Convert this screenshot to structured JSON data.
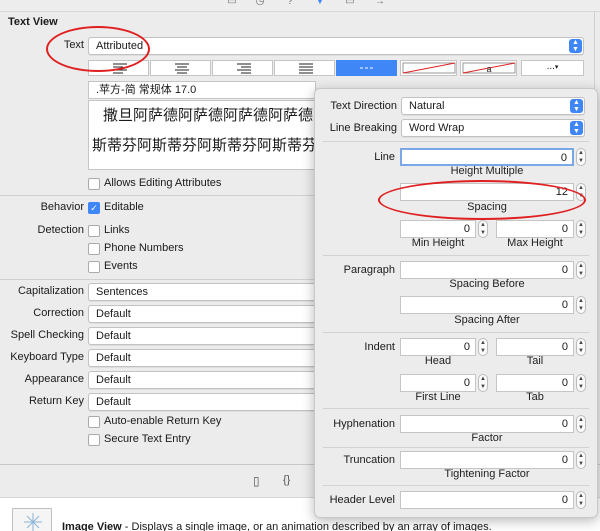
{
  "inspector": {
    "section_title": "Text View",
    "text_label": "Text",
    "text_value": "Attributed",
    "font_value": ".苹方-简 常规体 17.0",
    "preview_line1": "撒旦阿萨德阿萨德阿萨德阿萨德",
    "preview_line2": "斯蒂芬阿斯蒂芬阿斯蒂芬阿斯蒂芬",
    "allows_editing": "Allows Editing Attributes",
    "behavior_label": "Behavior",
    "editable": "Editable",
    "detection_label": "Detection",
    "links": "Links",
    "phone_numbers": "Phone Numbers",
    "events": "Events",
    "capitalization_label": "Capitalization",
    "capitalization_value": "Sentences",
    "correction_label": "Correction",
    "correction_value": "Default",
    "spell_label": "Spell Checking",
    "spell_value": "Default",
    "keyboard_label": "Keyboard Type",
    "keyboard_value": "Default",
    "appearance_label": "Appearance",
    "appearance_value": "Default",
    "return_label": "Return Key",
    "return_value": "Default",
    "auto_enable": "Auto-enable Return Key",
    "secure": "Secure Text Entry",
    "more_label": "...",
    "image_view_bold": "Image View",
    "image_view_desc": " - Displays a single image, or an animation described by an array of images."
  },
  "popover": {
    "text_direction_label": "Text Direction",
    "text_direction_value": "Natural",
    "line_breaking_label": "Line Breaking",
    "line_breaking_value": "Word Wrap",
    "line_label": "Line",
    "line_value": "0",
    "height_multiple": "Height Multiple",
    "spacing_value": "12",
    "spacing": "Spacing",
    "min_height_value": "0",
    "max_height_value": "0",
    "min_height": "Min Height",
    "max_height": "Max Height",
    "paragraph_label": "Paragraph",
    "spacing_before_value": "0",
    "spacing_before": "Spacing Before",
    "spacing_after_value": "0",
    "spacing_after": "Spacing After",
    "indent_label": "Indent",
    "head_value": "0",
    "tail_value": "0",
    "head": "Head",
    "tail": "Tail",
    "first_line_value": "0",
    "tab_value": "0",
    "first_line": "First Line",
    "tab": "Tab",
    "hyphenation_label": "Hyphenation",
    "factor_value": "0",
    "factor": "Factor",
    "truncation_label": "Truncation",
    "tightening_value": "0",
    "tightening": "Tightening Factor",
    "header_level_label": "Header Level",
    "header_level_value": "0"
  },
  "toolbar_icons": [
    "file-icon",
    "clock-icon",
    "shield-icon",
    "grid-icon",
    "ruler-icon",
    "arrow-icon"
  ],
  "bottom_icons": [
    "file-icon",
    "braces-icon"
  ],
  "colors": {
    "accent": "#3f86f7",
    "annotation": "#e02020",
    "panel": "#ececec"
  }
}
